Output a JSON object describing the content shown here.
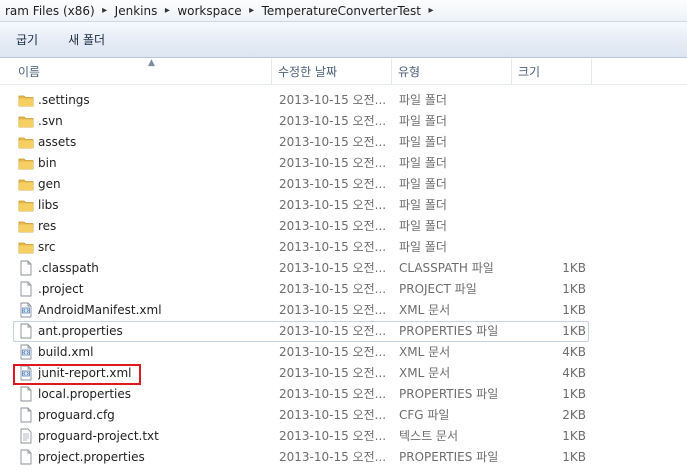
{
  "address": {
    "crumbs": [
      "ram Files (x86)",
      "Jenkins",
      "workspace",
      "TemperatureConverterTest"
    ]
  },
  "toolbar": {
    "organize_label": "굽기",
    "new_folder_label": "새 폴더"
  },
  "columns": {
    "name": "이름",
    "date": "수정한 날짜",
    "type": "유형",
    "size": "크기"
  },
  "files": [
    {
      "name": ".settings",
      "date": "2013-10-15 오전...",
      "type": "파일 폴더",
      "size": "",
      "icon": "folder-icon"
    },
    {
      "name": ".svn",
      "date": "2013-10-15 오전...",
      "type": "파일 폴더",
      "size": "",
      "icon": "folder-icon"
    },
    {
      "name": "assets",
      "date": "2013-10-15 오전...",
      "type": "파일 폴더",
      "size": "",
      "icon": "folder-icon"
    },
    {
      "name": "bin",
      "date": "2013-10-15 오전...",
      "type": "파일 폴더",
      "size": "",
      "icon": "folder-icon"
    },
    {
      "name": "gen",
      "date": "2013-10-15 오전...",
      "type": "파일 폴더",
      "size": "",
      "icon": "folder-icon"
    },
    {
      "name": "libs",
      "date": "2013-10-15 오전...",
      "type": "파일 폴더",
      "size": "",
      "icon": "folder-icon"
    },
    {
      "name": "res",
      "date": "2013-10-15 오전...",
      "type": "파일 폴더",
      "size": "",
      "icon": "folder-icon"
    },
    {
      "name": "src",
      "date": "2013-10-15 오전...",
      "type": "파일 폴더",
      "size": "",
      "icon": "folder-icon"
    },
    {
      "name": ".classpath",
      "date": "2013-10-15 오전...",
      "type": "CLASSPATH 파일",
      "size": "1KB",
      "icon": "file-icon"
    },
    {
      "name": ".project",
      "date": "2013-10-15 오전...",
      "type": "PROJECT 파일",
      "size": "1KB",
      "icon": "file-icon"
    },
    {
      "name": "AndroidManifest.xml",
      "date": "2013-10-15 오전...",
      "type": "XML 문서",
      "size": "1KB",
      "icon": "xml-file-icon"
    },
    {
      "name": "ant.properties",
      "date": "2013-10-15 오전...",
      "type": "PROPERTIES 파일",
      "size": "1KB",
      "icon": "file-icon"
    },
    {
      "name": "build.xml",
      "date": "2013-10-15 오전...",
      "type": "XML 문서",
      "size": "4KB",
      "icon": "xml-file-icon"
    },
    {
      "name": "junit-report.xml",
      "date": "2013-10-15 오전...",
      "type": "XML 문서",
      "size": "4KB",
      "icon": "xml-file-icon"
    },
    {
      "name": "local.properties",
      "date": "2013-10-15 오전...",
      "type": "PROPERTIES 파일",
      "size": "1KB",
      "icon": "file-icon"
    },
    {
      "name": "proguard.cfg",
      "date": "2013-10-15 오전...",
      "type": "CFG 파일",
      "size": "2KB",
      "icon": "file-icon"
    },
    {
      "name": "proguard-project.txt",
      "date": "2013-10-15 오전...",
      "type": "텍스트 문서",
      "size": "1KB",
      "icon": "text-file-icon"
    },
    {
      "name": "project.properties",
      "date": "2013-10-15 오전...",
      "type": "PROPERTIES 파일",
      "size": "1KB",
      "icon": "file-icon"
    }
  ],
  "colors": {
    "highlight_box": "#e0171f",
    "hover_row_border": "#c4d3e6",
    "folder": "#e8b94a"
  }
}
